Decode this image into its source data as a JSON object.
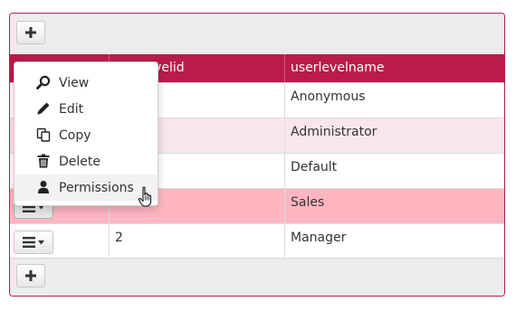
{
  "grid": {
    "add_button_top_icon": "plus-icon",
    "add_button_bottom_icon": "plus-icon",
    "columns": [
      "",
      "userlevelid",
      "userlevelname"
    ],
    "rows": [
      {
        "userlevelid": "",
        "userlevelname": "Anonymous"
      },
      {
        "userlevelid": "",
        "userlevelname": "Administrator"
      },
      {
        "userlevelid": "",
        "userlevelname": "Default"
      },
      {
        "userlevelid": "",
        "userlevelname": "Sales"
      },
      {
        "userlevelid": "2",
        "userlevelname": "Manager"
      }
    ],
    "header_visible_fragment": "elid"
  },
  "menu": {
    "items": [
      {
        "label": "View",
        "icon": "search-icon"
      },
      {
        "label": "Edit",
        "icon": "pencil-icon"
      },
      {
        "label": "Copy",
        "icon": "copy-icon"
      },
      {
        "label": "Delete",
        "icon": "trash-icon"
      },
      {
        "label": "Permissions",
        "icon": "user-icon"
      }
    ]
  },
  "colors": {
    "accent": "#b91c4b",
    "selected_row": "#ffb6c1",
    "striped_row": "#f7e6ea"
  }
}
